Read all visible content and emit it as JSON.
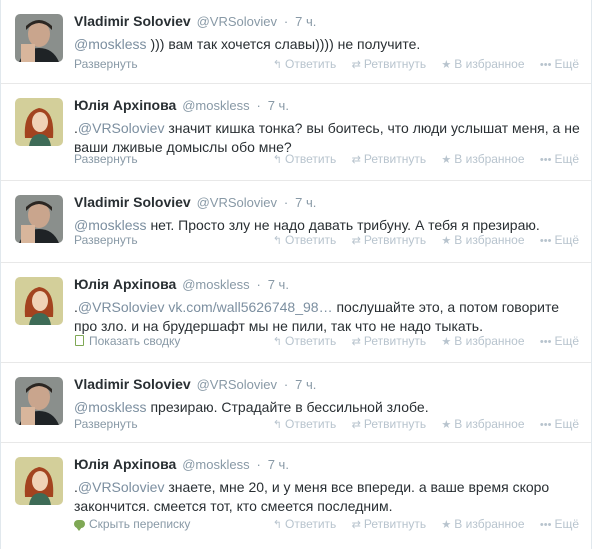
{
  "accent": "#8899a6",
  "tweets": [
    {
      "fullname": "Vladimir Soloviev",
      "username": "@VRSoloviev",
      "dot": "·",
      "time": "7 ч.",
      "prefix": "",
      "mention": "@moskless",
      "text": " ))) вам так хочется славы)))) не получите.",
      "expand_label": "Развернуть",
      "expand_icon": "",
      "avatar": "man"
    },
    {
      "fullname": "Юлія Архіпова",
      "username": "@moskless",
      "dot": "·",
      "time": "7 ч.",
      "prefix": ".",
      "mention": "@VRSoloviev",
      "text": " значит кишка тонка? вы боитесь, что люди услышат меня, а не ваши лживые домыслы обо мне?",
      "expand_label": "Развернуть",
      "expand_icon": "",
      "avatar": "woman"
    },
    {
      "fullname": "Vladimir Soloviev",
      "username": "@VRSoloviev",
      "dot": "·",
      "time": "7 ч.",
      "prefix": "",
      "mention": "@moskless",
      "text": " нет. Просто злу не надо давать трибуну. А тебя я презираю.",
      "expand_label": "Развернуть",
      "expand_icon": "",
      "avatar": "man"
    },
    {
      "fullname": "Юлія Архіпова",
      "username": "@moskless",
      "dot": "·",
      "time": "7 ч.",
      "prefix": ".",
      "mention": "@VRSoloviev",
      "link": " vk.com/wall5626748_98…",
      "text": " послушайте это, а потом говорите про зло. и на брудершафт мы не пили, так что не надо тыкать.",
      "expand_label": "Показать сводку",
      "expand_icon": "summary-icon",
      "avatar": "woman"
    },
    {
      "fullname": "Vladimir Soloviev",
      "username": "@VRSoloviev",
      "dot": "·",
      "time": "7 ч.",
      "prefix": "",
      "mention": "@moskless",
      "text": " презираю. Страдайте в бессильной злобе.",
      "expand_label": "Развернуть",
      "expand_icon": "",
      "avatar": "man"
    },
    {
      "fullname": "Юлія Архіпова",
      "username": "@moskless",
      "dot": "·",
      "time": "7 ч.",
      "prefix": ".",
      "mention": "@VRSoloviev",
      "text": " знаете, мне 20, и у меня все впереди. а ваше время скоро закончится. смеется тот, кто смеется последним.",
      "expand_label": "Скрыть переписку",
      "expand_icon": "conversation-icon",
      "avatar": "woman"
    }
  ],
  "actions": {
    "reply": "Ответить",
    "retweet": "Ретвитнуть",
    "favorite": "В избранное",
    "more": "Ещё",
    "reply_icon": "↰",
    "retweet_icon": "⇄",
    "favorite_icon": "★",
    "more_icon": "•••"
  }
}
